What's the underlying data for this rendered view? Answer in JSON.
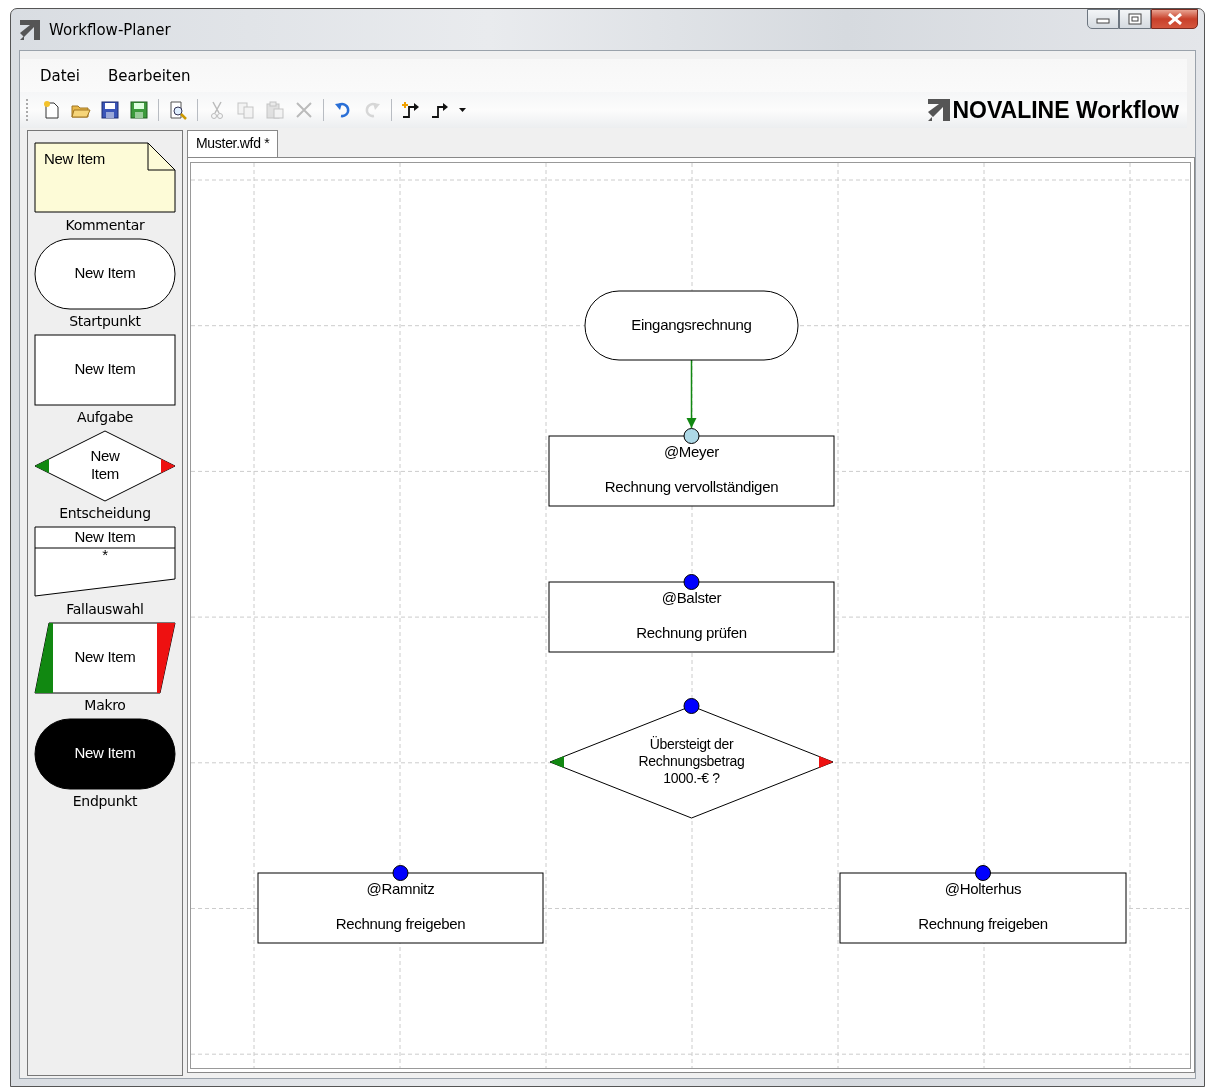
{
  "window": {
    "title": "Workflow-Planer"
  },
  "menu": [
    {
      "label": "Datei"
    },
    {
      "label": "Bearbeiten"
    }
  ],
  "toolbar": [
    {
      "kind": "new",
      "disabled": false
    },
    {
      "kind": "open",
      "disabled": false
    },
    {
      "kind": "save",
      "disabled": false
    },
    {
      "kind": "saveas",
      "disabled": false
    },
    {
      "kind": "sep"
    },
    {
      "kind": "preview",
      "disabled": false
    },
    {
      "kind": "sep"
    },
    {
      "kind": "cut",
      "disabled": true
    },
    {
      "kind": "copy",
      "disabled": true
    },
    {
      "kind": "paste",
      "disabled": true
    },
    {
      "kind": "delete",
      "disabled": true
    },
    {
      "kind": "sep"
    },
    {
      "kind": "undo",
      "disabled": false
    },
    {
      "kind": "redo",
      "disabled": true
    },
    {
      "kind": "sep"
    },
    {
      "kind": "addconnector",
      "disabled": false
    },
    {
      "kind": "connector",
      "disabled": false
    },
    {
      "kind": "dropdown",
      "disabled": false
    }
  ],
  "brand": "NOVALINE Workflow",
  "palette": [
    {
      "kind": "comment",
      "text": "New Item",
      "label": "Kommentar"
    },
    {
      "kind": "start",
      "text": "New Item",
      "label": "Startpunkt"
    },
    {
      "kind": "task",
      "text": "New Item",
      "label": "Aufgabe"
    },
    {
      "kind": "decision",
      "text": "New\nItem",
      "label": "Entscheidung"
    },
    {
      "kind": "case",
      "text": "New Item",
      "subtext": "*",
      "label": "Fallauswahl"
    },
    {
      "kind": "macro",
      "text": "New Item",
      "label": "Makro"
    },
    {
      "kind": "end",
      "text": "New Item",
      "label": "Endpunkt"
    }
  ],
  "tabs": [
    {
      "label": "Muster.wfd *",
      "selected": true
    }
  ],
  "nodes": [
    {
      "kind": "start",
      "text": "Eingangsrechnung"
    },
    {
      "kind": "task",
      "assignee": "@Meyer",
      "text": "Rechnung vervollständigen",
      "connected": true
    },
    {
      "kind": "task",
      "assignee": "@Balster",
      "text": "Rechnung prüfen",
      "connected": false
    },
    {
      "kind": "decision",
      "text": "Übersteigt der\nRechnungsbetrag\n1000.-€ ?",
      "connected": false
    },
    {
      "kind": "task",
      "assignee": "@Ramnitz",
      "text": "Rechnung freigeben",
      "connected": false
    },
    {
      "kind": "task",
      "assignee": "@Holterhus",
      "text": "Rechnung freigeben",
      "connected": false
    }
  ]
}
